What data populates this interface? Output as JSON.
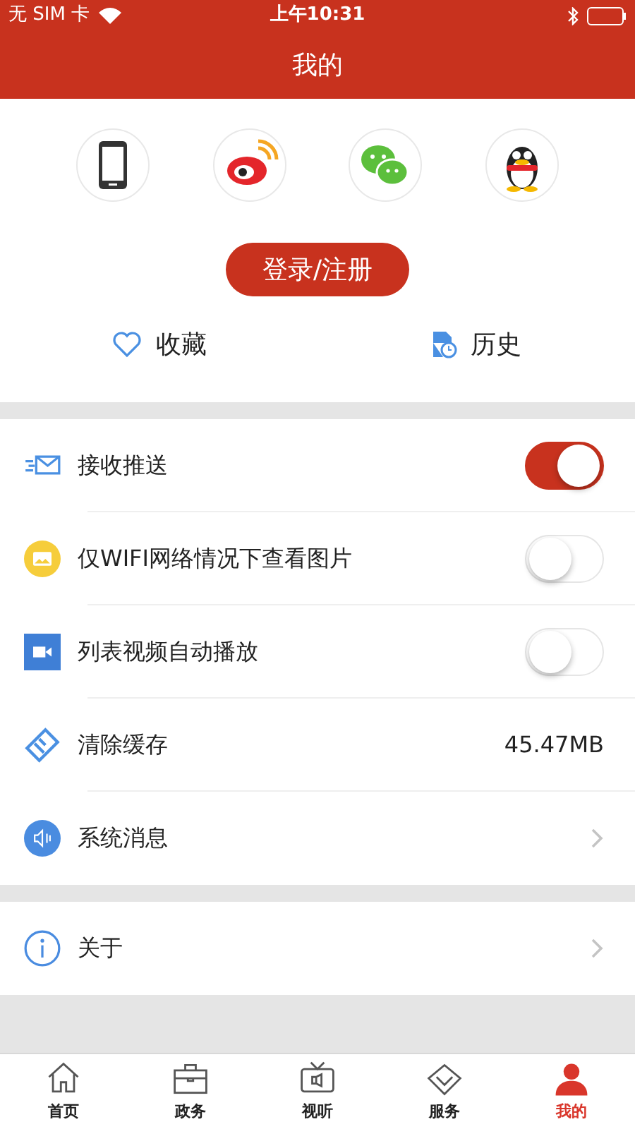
{
  "status_bar": {
    "carrier": "无 SIM 卡",
    "time": "上午10:31"
  },
  "header": {
    "title": "我的"
  },
  "login": {
    "button": "登录/注册"
  },
  "shortcuts": [
    {
      "label": "收藏"
    },
    {
      "label": "历史"
    }
  ],
  "settings": [
    {
      "kind": "toggle",
      "label": "接收推送",
      "on": true
    },
    {
      "kind": "toggle",
      "label": "仅WIFI网络情况下查看图片",
      "on": false
    },
    {
      "kind": "toggle",
      "label": "列表视频自动播放",
      "on": false
    },
    {
      "kind": "value",
      "label": "清除缓存",
      "value": "45.47MB"
    },
    {
      "kind": "chevron",
      "label": "系统消息"
    }
  ],
  "about": [
    {
      "kind": "chevron",
      "label": "关于"
    }
  ],
  "tabs": [
    {
      "label": "首页",
      "selected": false
    },
    {
      "label": "政务",
      "selected": false
    },
    {
      "label": "视听",
      "selected": false
    },
    {
      "label": "服务",
      "selected": false
    },
    {
      "label": "我的",
      "selected": true
    }
  ]
}
